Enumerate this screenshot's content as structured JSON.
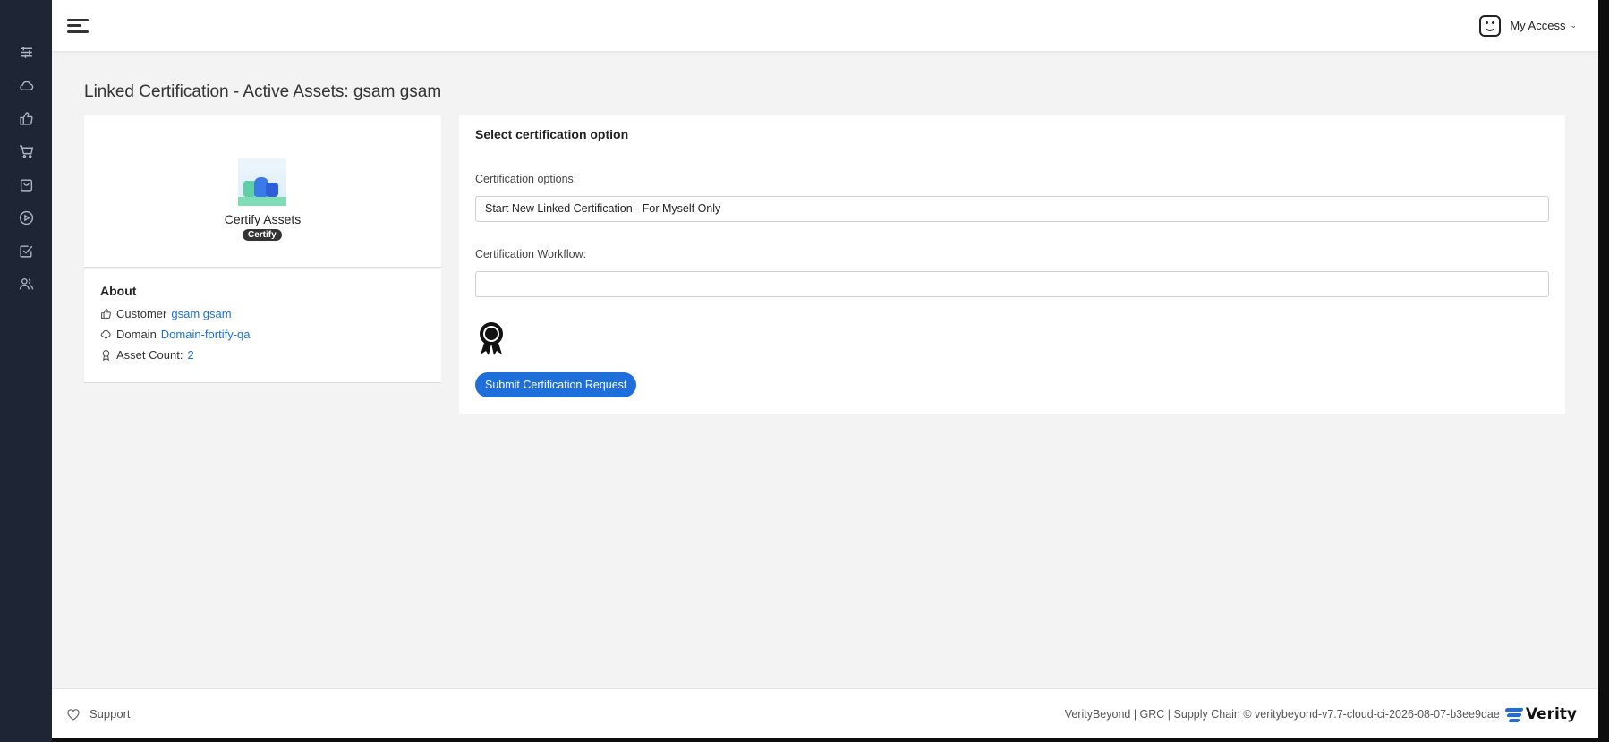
{
  "sidebar": {
    "items": [
      {
        "icon": "sliders-icon"
      },
      {
        "icon": "cloud-icon"
      },
      {
        "icon": "thumbs-up-icon"
      },
      {
        "icon": "cart-icon"
      },
      {
        "icon": "bag-icon"
      },
      {
        "icon": "play-icon"
      },
      {
        "icon": "checkbox-icon"
      },
      {
        "icon": "users-icon"
      }
    ]
  },
  "header": {
    "account_label": "My Access"
  },
  "page": {
    "title": "Linked Certification - Active Assets: gsam gsam"
  },
  "profile": {
    "name": "Certify Assets",
    "badge": "Certify"
  },
  "about": {
    "title": "About",
    "customer_label": "Customer",
    "customer_value": "gsam gsam",
    "domain_label": "Domain",
    "domain_value": "Domain-fortify-qa",
    "asset_count_label": "Asset Count:",
    "asset_count_value": "2"
  },
  "options": {
    "title": "Select certification option",
    "cert_options_label": "Certification options:",
    "cert_options_value": "Start New Linked Certification - For Myself Only",
    "workflow_label": "Certification Workflow:",
    "workflow_value": "",
    "submit_label": "Submit Certification Request"
  },
  "footer": {
    "support_label": "Support",
    "copyright": "VerityBeyond | GRC | Supply Chain © veritybeyond-v7.7-cloud-ci-2026-08-07-b3ee9dae",
    "brand": "Verity"
  },
  "colors": {
    "sidebar_bg": "#1e2636",
    "accent": "#1e6fd9",
    "link": "#1a6fd6"
  }
}
